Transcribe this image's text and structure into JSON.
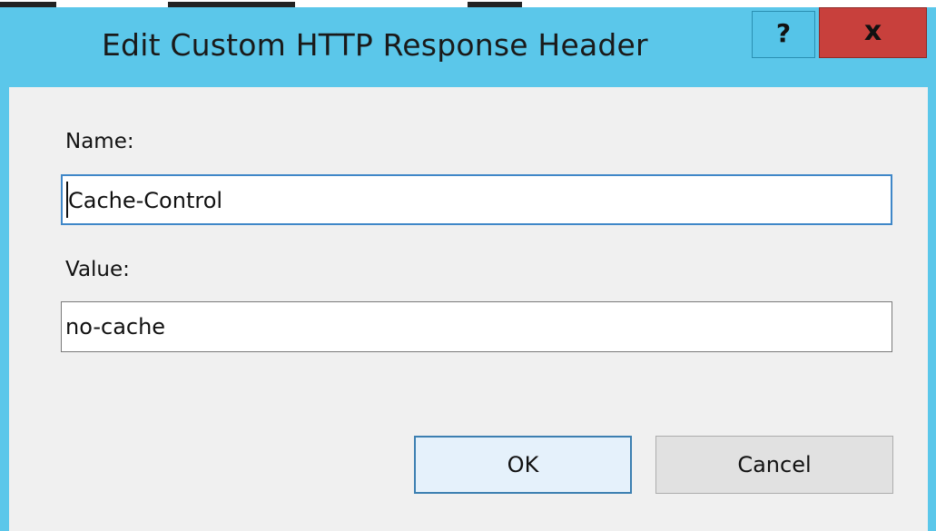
{
  "dialog": {
    "title": "Edit Custom HTTP Response Header",
    "help_glyph": "?",
    "close_glyph": "x"
  },
  "form": {
    "name_label": "Name:",
    "name_value": "Cache-Control",
    "value_label": "Value:",
    "value_value": "no-cache"
  },
  "buttons": {
    "ok_label": "OK",
    "cancel_label": "Cancel"
  },
  "colors": {
    "titlebar": "#5bc7ea",
    "close_button": "#c8403c",
    "client_area": "#f0f0f0",
    "focus_border": "#3f87c8"
  }
}
